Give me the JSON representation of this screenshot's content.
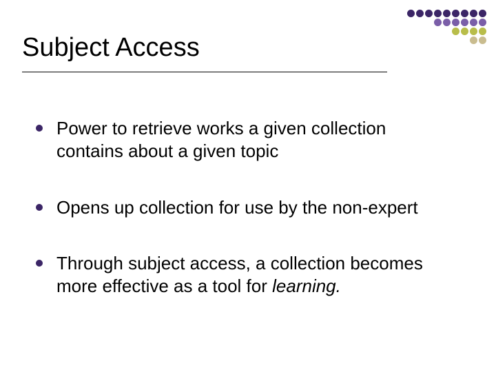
{
  "title": "Subject Access",
  "bullets": [
    {
      "text": "Power to retrieve works a given collection contains about a given topic"
    },
    {
      "text": "Opens up collection for use by the non-expert"
    },
    {
      "text_prefix": "Through subject access, a collection becomes more effective as a tool for ",
      "text_em": "learning."
    }
  ],
  "decor": {
    "colors": {
      "purple_dark": "#3b2566",
      "purple_mid": "#7a5ea8",
      "olive": "#b8bd4a",
      "tan": "#c9bc8f"
    },
    "grid": [
      [
        "purple_dark",
        "purple_dark",
        "purple_dark",
        "purple_dark",
        "purple_dark",
        "purple_dark",
        "purple_dark",
        "purple_dark",
        "purple_dark"
      ],
      [
        "none",
        "none",
        "none",
        "purple_mid",
        "purple_mid",
        "purple_mid",
        "purple_mid",
        "purple_mid",
        "purple_mid"
      ],
      [
        "none",
        "none",
        "none",
        "none",
        "none",
        "olive",
        "olive",
        "olive",
        "olive"
      ],
      [
        "none",
        "none",
        "none",
        "none",
        "none",
        "none",
        "none",
        "tan",
        "tan"
      ]
    ]
  }
}
